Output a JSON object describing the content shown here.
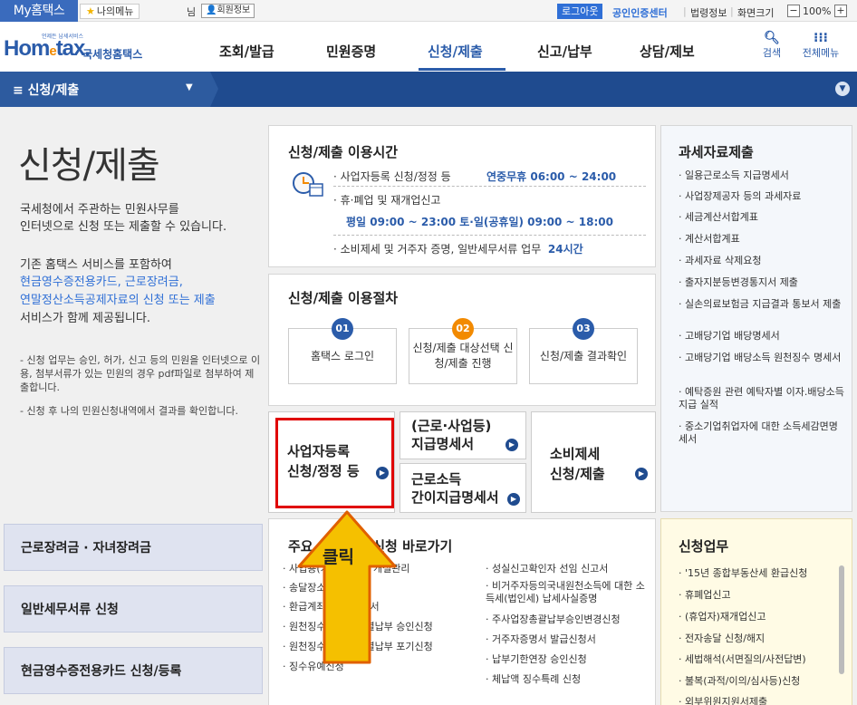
{
  "topbar": {
    "my_hometax": "My홈택스",
    "my_menu": "나의메뉴",
    "user_suffix": "님",
    "user_info": "회원정보",
    "logout": "로그아웃",
    "cert_center": "공인인증센터",
    "law_info": "법령정보",
    "screen_size": "화면크기",
    "zoom_value": "100%",
    "zoom_minus": "−",
    "zoom_plus": "+"
  },
  "header": {
    "logo_small": "언제든 납세서비스",
    "logo_text": "Hometax.",
    "logo_kr": "국세청홈택스",
    "nav": [
      "조회/발급",
      "민원증명",
      "신청/제출",
      "신고/납부",
      "상담/제보"
    ],
    "search": "검색",
    "all_menu": "전체메뉴"
  },
  "subnav": {
    "title": "≡  신청/제출"
  },
  "intro": {
    "title": "신청/제출",
    "line1": "국세청에서 주관하는 민원사무를",
    "line2": "인터넷으로 신청 또는 제출할 수 있습니다.",
    "line3": "기존 홈택스 서비스를 포함하여",
    "line4": "현금영수증전용카드, 근로장려금,",
    "line5": "연말정산소득공제자료의 신청 또는 제출",
    "line6": "서비스가 함께 제공됩니다.",
    "note1": "- 신청 업무는 승인, 허가, 신고 등의 민원을 인터넷으로 이용, 첨부서류가 있는 민원의 경우 pdf파일로 첨부하여 제출합니다.",
    "note2": "- 신청 후 나의 민원신청내역에서 결과를 확인합니다."
  },
  "hours": {
    "title": "신청/제출 이용시간",
    "row1": "· 사업자등록 신청/정정 등",
    "row1_time": "연중무휴 06:00 ~ 24:00",
    "row2": "· 휴·폐업 및 재개업신고",
    "row3": "평일 09:00 ~ 23:00 토·일(공휴일) 09:00 ~ 18:00",
    "row4": "· 소비제세 및 거주자 증명, 일반세무서류 업무",
    "row4_time": "24시간"
  },
  "procedure": {
    "title": "신청/제출 이용절차",
    "steps": [
      {
        "num": "01",
        "label": "홈택스 로그인"
      },
      {
        "num": "02",
        "label": "신청/제출 대상선택 신청/제출 진행"
      },
      {
        "num": "03",
        "label": "신청/제출 결과확인"
      }
    ]
  },
  "buttons": {
    "biz_reg_1": "사업자등록",
    "biz_reg_2": "신청/정정 등",
    "wage_1": "(근로·사업등)",
    "wage_2": "지급명세서",
    "simple_1": "근로소득",
    "simple_2": "간이지급명세서",
    "excise_1": "소비제세",
    "excise_2": "신청/제출"
  },
  "tax_data": {
    "title": "과세자료제출",
    "items": [
      "· 일용근로소득 지급명세서",
      "· 사업장제공자 등의 과세자료",
      "· 세금계산서합계표",
      "· 계산서합계표",
      "· 과세자료 삭제요청",
      "· 출자지분등변경통지서 제출",
      "· 실손의료보험금 지급결과 통보서 제출",
      "· 고배당기업 배당명세서",
      "· 고배당기업 배당소득 원천징수 명세서",
      "· 예탁증원 관련 예탁자별 이자.배당소득 지급 실적",
      "· 중소기업취업자에 대한 소득세감면명세서"
    ]
  },
  "left_menu": [
    "근로장려금 · 자녀장려금",
    "일반세무서류 신청",
    "현금영수증전용카드 신청/등록"
  ],
  "shortcuts": {
    "title": "주요 세무서류 신청 바로가기",
    "col1": [
      "· 사업용(가정용)계좌 개설관리",
      "· 송달장소 변경 신고",
      "· 환급계좌(변경)신고서",
      "· 원천징수세액 반기별납부 승인신청",
      "· 원천징수세액 반기별납부 포기신청",
      "· 징수유예신청"
    ],
    "col2": [
      "· 성실신고확인자 선임 신고서",
      "· 비거주자등의국내원천소득에 대한 소득세(법인세) 납세사실증명",
      "· 주사업장총괄납부승인변경신청",
      "· 거주자증명서 발급신청서",
      "· 납부기한연장 승인신청",
      "· 체납액 징수특례 신청"
    ]
  },
  "applications": {
    "title": "신청업무",
    "items": [
      "· '15년 종합부동산세 환급신청",
      "· 휴폐업신고",
      "· (휴업자)재개업신고",
      "· 전자송달 신청/해지",
      "· 세법해석(서면질의/사전답변)",
      "· 불복(과적/이의/심사등)신청",
      "· 외부위원지원서제출"
    ]
  },
  "overlay": {
    "label": "클릭"
  }
}
